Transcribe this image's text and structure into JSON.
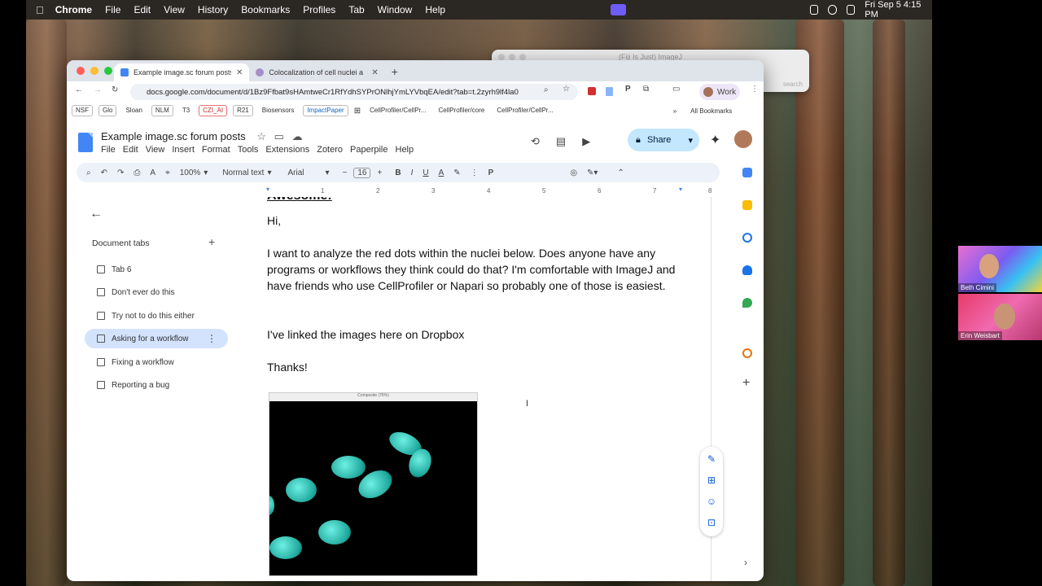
{
  "menubar": {
    "app": "Chrome",
    "items": [
      "File",
      "Edit",
      "View",
      "History",
      "Bookmarks",
      "Profiles",
      "Tab",
      "Window",
      "Help"
    ],
    "datetime": "Fri Sep 5  4:15 PM"
  },
  "fiji": {
    "title": "(Fiji Is Just) ImageJ",
    "search": "search"
  },
  "tabs": [
    {
      "label": "Example image.sc forum posts"
    },
    {
      "label": "Colocalization of cell nuclei a"
    }
  ],
  "url": "docs.google.com/document/d/1Bz9Ffbat9sHAmtweCr1RfYdhSYPrONlhjYmLYVbqEA/edit?tab=t.2zyrh9lf4la0",
  "profile": "Work",
  "bookmarks": [
    "NSF",
    "Glo",
    "Sloan",
    "NLM",
    "T3",
    "CZI_AI",
    "R21",
    "Biosensors",
    "ImpactPaper",
    "CellProfiler/CellPr...",
    "CellProfiler/core",
    "CellProfiler/CellPr..."
  ],
  "all_bookmarks": "All Bookmarks",
  "doc": {
    "title": "Example image.sc forum posts",
    "menus": [
      "File",
      "Edit",
      "View",
      "Insert",
      "Format",
      "Tools",
      "Extensions",
      "Zotero",
      "Paperpile",
      "Help"
    ],
    "share": "Share"
  },
  "format": {
    "zoom": "100%",
    "style": "Normal text",
    "font": "Arial",
    "size": "16"
  },
  "ruler": [
    "1",
    "2",
    "3",
    "4",
    "5",
    "6",
    "7",
    "8"
  ],
  "doc_tabs": {
    "header": "Document tabs",
    "items": [
      "Tab 6",
      "Don't ever do this",
      "Try not to do this either",
      "Asking for a workflow",
      "Fixing a workflow",
      "Reporting a bug"
    ]
  },
  "content": {
    "heading": "Awesome!",
    "greeting": "Hi,",
    "body1": "I want to analyze the red dots within the nuclei below. Does anyone have any programs or workflows they think could do that? I'm comfortable with ImageJ and have friends who use CellProfiler or Napari so probably one of those is easiest.",
    "body2": "I've linked the images here on Dropbox",
    "thanks": "Thanks!",
    "image_title": "Composite (76%)"
  },
  "video": [
    {
      "name": "Beth Cimini"
    },
    {
      "name": "Erin Weisbart"
    }
  ],
  "colors": {
    "accent": "#0b57d0",
    "share_bg": "#c2e7ff",
    "selected_tab": "#d3e3fd",
    "nuclei": "#2fd0c2"
  }
}
